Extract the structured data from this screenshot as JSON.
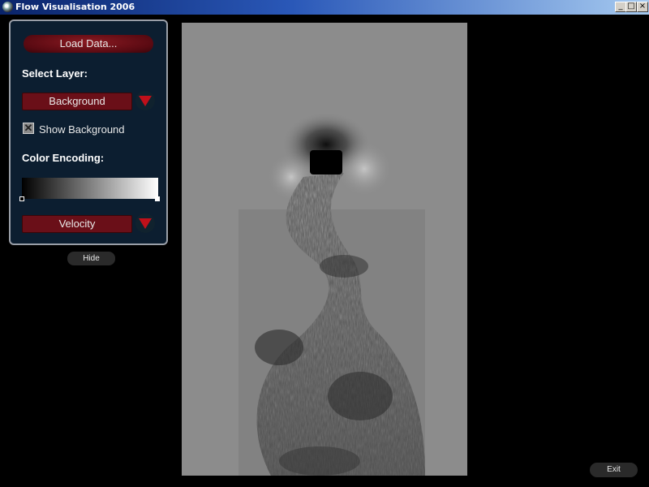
{
  "window": {
    "title": "Flow Visualisation 2006",
    "minimize_glyph": "_",
    "maximize_glyph": "□",
    "close_glyph": "×"
  },
  "panel": {
    "load_label": "Load Data...",
    "select_layer_label": "Select Layer:",
    "layer_value": "Background",
    "show_background_label": "Show Background",
    "show_background_checked": true,
    "check_glyph": "✕",
    "color_encoding_label": "Color Encoding:",
    "colormap": {
      "from": "#000000",
      "to": "#ffffff"
    },
    "property_value": "Velocity",
    "hide_label": "Hide"
  },
  "footer": {
    "exit_label": "Exit"
  },
  "colors": {
    "button_red": "#6a0f18",
    "panel_bg": "#0c1e30",
    "dropdown_arrow": "#c0101a"
  },
  "icons": [
    "app-icon",
    "dropdown-arrow-icon",
    "check-icon"
  ]
}
